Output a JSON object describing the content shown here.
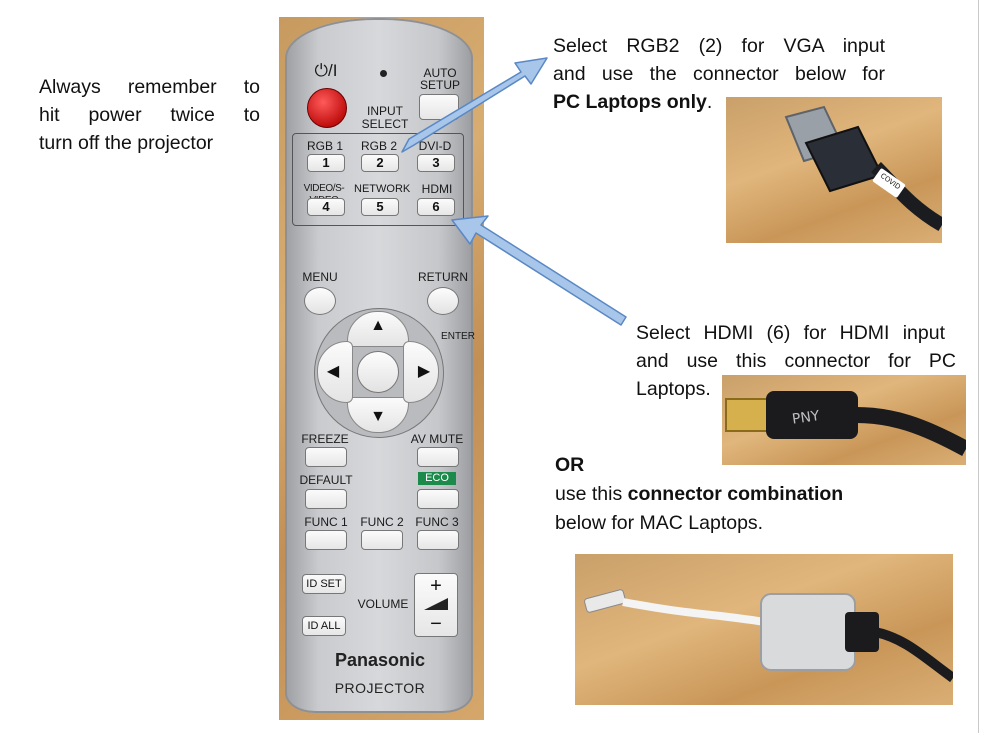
{
  "notes": {
    "power_lines": [
      "Always remember to",
      "hit power twice to",
      "turn off the projector"
    ],
    "vga_lines": [
      "Select RGB2 (2) for VGA input",
      "and use the connector below for"
    ],
    "vga_bold": "PC Laptops only",
    "vga_tail": ".",
    "hdmi_lines": [
      "Select HDMI (6) for HDMI input",
      "and use this connector for PC",
      "Laptops."
    ],
    "or": "OR",
    "mac_line1": "use this ",
    "mac_bold": "connector combination",
    "mac_line2": "below for MAC Laptops."
  },
  "remote": {
    "power_label": "⏻/I",
    "auto_setup": [
      "AUTO",
      "SETUP"
    ],
    "input_select": [
      "INPUT",
      "SELECT"
    ],
    "inputs": [
      {
        "label": "RGB 1",
        "num": "1"
      },
      {
        "label": "RGB 2",
        "num": "2"
      },
      {
        "label": "DVI-D",
        "num": "3"
      },
      {
        "label": "VIDEO/S-VIDEO",
        "num": "4"
      },
      {
        "label": "NETWORK",
        "num": "5"
      },
      {
        "label": "HDMI",
        "num": "6"
      }
    ],
    "menu": "MENU",
    "return": "RETURN",
    "enter": "ENTER",
    "freeze": "FREEZE",
    "av_mute": "AV MUTE",
    "default": "DEFAULT",
    "eco": "ECO",
    "func1": "FUNC 1",
    "func2": "FUNC 2",
    "func3": "FUNC 3",
    "id_set": "ID SET",
    "id_all": "ID ALL",
    "volume": "VOLUME",
    "vol_plus": "+",
    "vol_minus": "−",
    "brand": "Panasonic",
    "model": "PROJECTOR"
  },
  "connector_photos": {
    "vga_cable_text": "COVID",
    "hdmi_cable_text": "PNY"
  },
  "colors": {
    "power_button": "#d91a1a",
    "arrow_fill": "#a8c6ea",
    "arrow_stroke": "#5a88c4",
    "eco_badge": "#1c8a4a",
    "wood": "#c99a60"
  }
}
